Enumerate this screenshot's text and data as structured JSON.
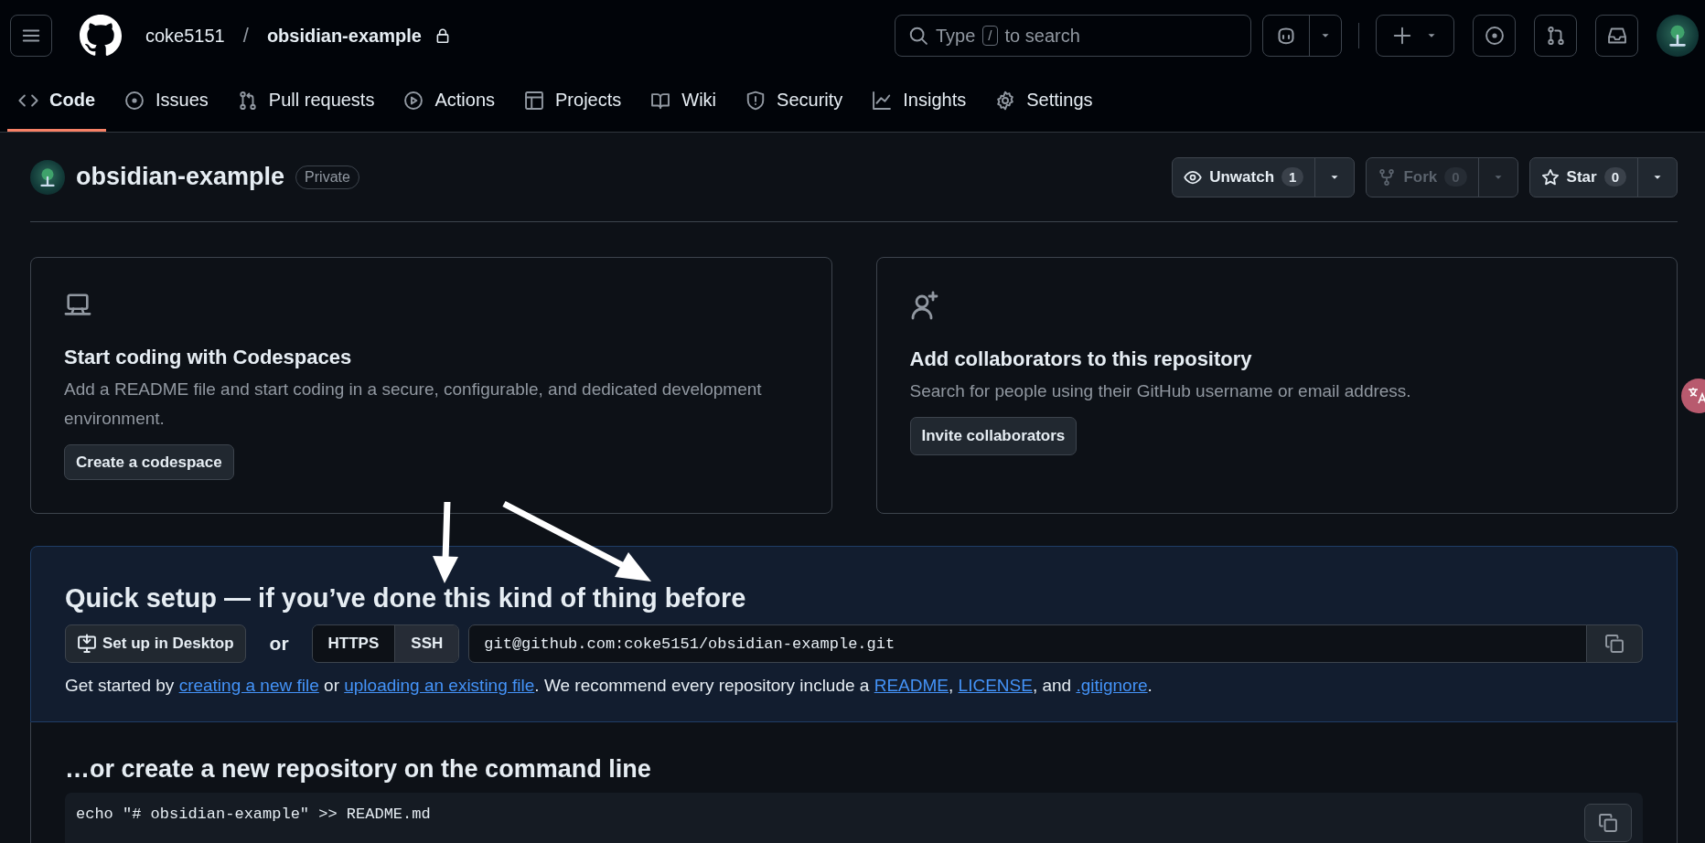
{
  "header": {
    "owner": "coke5151",
    "separator": "/",
    "repo": "obsidian-example",
    "search": {
      "prefix": "Type",
      "key": "/",
      "suffix": "to search"
    }
  },
  "nav_tabs": [
    {
      "label": "Code",
      "kind": "code",
      "selected": true
    },
    {
      "label": "Issues",
      "kind": "issues",
      "selected": false
    },
    {
      "label": "Pull requests",
      "kind": "pulls",
      "selected": false
    },
    {
      "label": "Actions",
      "kind": "actions",
      "selected": false
    },
    {
      "label": "Projects",
      "kind": "projects",
      "selected": false
    },
    {
      "label": "Wiki",
      "kind": "wiki",
      "selected": false
    },
    {
      "label": "Security",
      "kind": "security",
      "selected": false
    },
    {
      "label": "Insights",
      "kind": "insights",
      "selected": false
    },
    {
      "label": "Settings",
      "kind": "settings",
      "selected": false
    }
  ],
  "repo": {
    "name": "obsidian-example",
    "visibility": "Private",
    "actions": [
      {
        "kind": "watch",
        "label": "Unwatch",
        "count": "1",
        "disabled": false
      },
      {
        "kind": "fork",
        "label": "Fork",
        "count": "0",
        "disabled": true
      },
      {
        "kind": "star",
        "label": "Star",
        "count": "0",
        "disabled": false
      }
    ]
  },
  "cards": [
    {
      "kind": "codespaces",
      "title": "Start coding with Codespaces",
      "description": "Add a README file and start coding in a secure, configurable, and dedicated development environment.",
      "button": "Create a codespace"
    },
    {
      "kind": "collaborators",
      "title": "Add collaborators to this repository",
      "description": "Search for people using their GitHub username or email address.",
      "button": "Invite collaborators"
    }
  ],
  "quick_setup": {
    "title": "Quick setup — if you’ve done this kind of thing before",
    "desktop_button": "Set up in Desktop",
    "or": "or",
    "protocols": [
      {
        "label": "HTTPS",
        "selected": false
      },
      {
        "label": "SSH",
        "selected": true
      }
    ],
    "url": "git@github.com:coke5151/obsidian-example.git",
    "hint": [
      {
        "kind": "text",
        "text": "Get started by "
      },
      {
        "kind": "link",
        "text": "creating a new file"
      },
      {
        "kind": "text",
        "text": " or "
      },
      {
        "kind": "link",
        "text": "uploading an existing file"
      },
      {
        "kind": "text",
        "text": ". We recommend every repository include a "
      },
      {
        "kind": "link",
        "text": "README"
      },
      {
        "kind": "text",
        "text": ", "
      },
      {
        "kind": "link",
        "text": "LICENSE"
      },
      {
        "kind": "text",
        "text": ", and "
      },
      {
        "kind": "link",
        "text": ".gitignore"
      },
      {
        "kind": "text",
        "text": "."
      }
    ]
  },
  "command_line": {
    "title": "…or create a new repository on the command line",
    "lines": [
      "echo \"# obsidian-example\" >> README.md"
    ]
  }
}
